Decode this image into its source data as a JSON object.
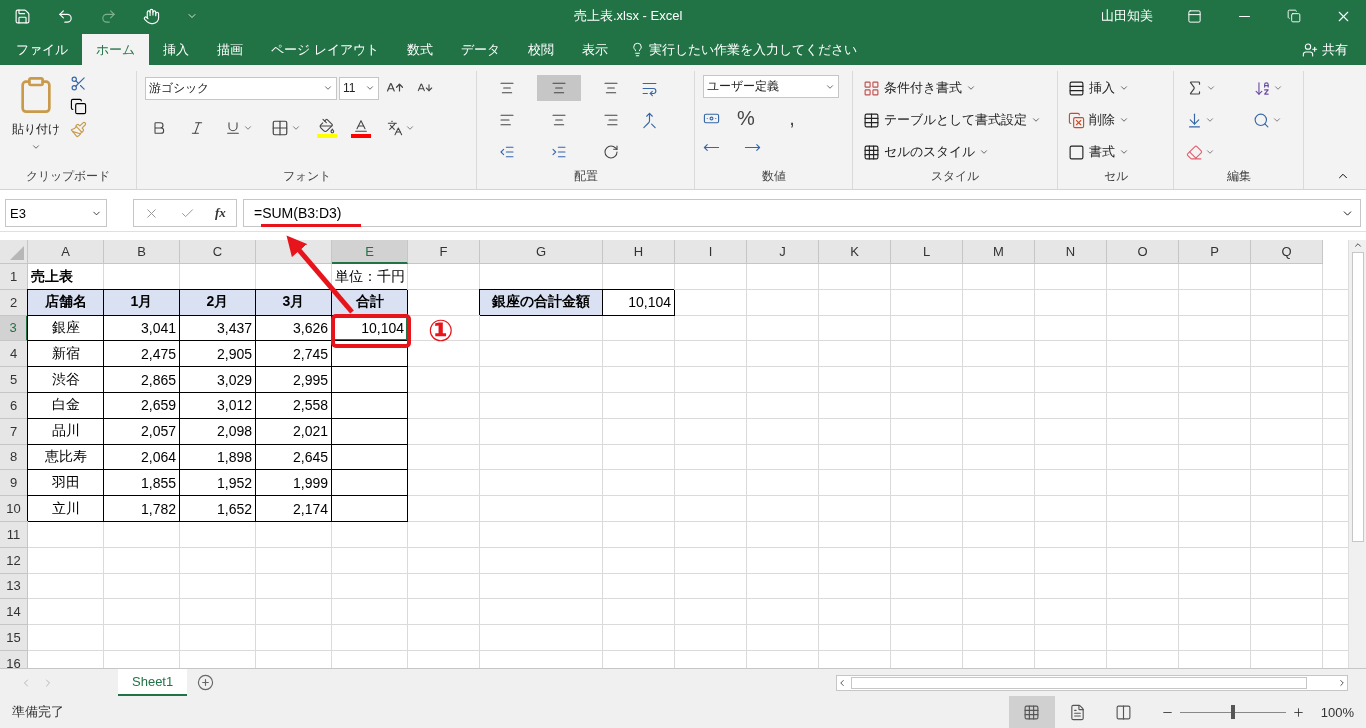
{
  "window": {
    "title": "売上表.xlsx  -  Excel",
    "user": "山田知美"
  },
  "tabs": [
    {
      "label": "ファイル",
      "selected": false
    },
    {
      "label": "ホーム",
      "selected": true
    },
    {
      "label": "挿入",
      "selected": false
    },
    {
      "label": "描画",
      "selected": false
    },
    {
      "label": "ページ レイアウト",
      "selected": false
    },
    {
      "label": "数式",
      "selected": false
    },
    {
      "label": "データ",
      "selected": false
    },
    {
      "label": "校閲",
      "selected": false
    },
    {
      "label": "表示",
      "selected": false
    }
  ],
  "tell_me": {
    "placeholder": "実行したい作業を入力してください"
  },
  "share": "共有",
  "ribbon": {
    "clipboard": {
      "paste": "貼り付け",
      "label": "クリップボード"
    },
    "font": {
      "font_name": "游ゴシック",
      "font_size": "11",
      "label": "フォント"
    },
    "alignment": {
      "vertical": [
        {
          "selected": false
        },
        {
          "selected": true
        },
        {
          "selected": false
        }
      ],
      "label": "配置"
    },
    "number": {
      "format": "ユーザー定義",
      "percent": "%",
      "comma": ",",
      "label": "数値"
    },
    "styles": {
      "buttons": [
        "条件付き書式",
        "テーブルとして書式設定",
        "セルのスタイル"
      ],
      "label": "スタイル"
    },
    "cells": {
      "buttons": [
        "挿入",
        "削除",
        "書式"
      ],
      "label": "セル"
    },
    "editing": {
      "label": "編集"
    }
  },
  "formula_bar": {
    "name_box": "E3",
    "function_label": "fx",
    "formula": "=SUM(B3:D3)"
  },
  "columns": [
    {
      "label": "A",
      "selected": false
    },
    {
      "label": "B",
      "selected": false
    },
    {
      "label": "C",
      "selected": false
    },
    {
      "selected": false
    },
    {
      "label": "E",
      "selected": true
    },
    {
      "label": "F",
      "selected": false
    },
    {
      "label": "G",
      "selected": false
    },
    {
      "label": "H",
      "selected": false
    },
    {
      "label": "I",
      "selected": false
    },
    {
      "label": "J",
      "selected": false
    },
    {
      "label": "K",
      "selected": false
    },
    {
      "label": "L",
      "selected": false
    },
    {
      "label": "M",
      "selected": false
    },
    {
      "label": "N",
      "selected": false
    },
    {
      "label": "O",
      "selected": false
    },
    {
      "label": "P",
      "selected": false
    },
    {
      "label": "Q",
      "selected": false
    }
  ],
  "rows": [
    {
      "number": "1",
      "selected": false,
      "cells": [
        {
          "kind": "title",
          "text": "売上表"
        },
        {
          "kind": "empty"
        },
        {
          "kind": "empty"
        },
        {
          "kind": "empty"
        },
        {
          "kind": "note",
          "text": "単位：千円"
        }
      ]
    },
    {
      "number": "2",
      "selected": false,
      "cells": [
        {
          "kind": "header",
          "text": "店舗名"
        },
        {
          "kind": "header",
          "text": "1月"
        },
        {
          "kind": "header",
          "text": "2月"
        },
        {
          "kind": "header",
          "text": "3月"
        },
        {
          "kind": "header",
          "text": "合計"
        },
        {
          "kind": "empty"
        },
        {
          "kind": "header",
          "text": "銀座の合計金額"
        },
        {
          "kind": "num",
          "text": "10,104"
        }
      ]
    },
    {
      "number": "3",
      "selected": true,
      "cells": [
        {
          "kind": "name",
          "text": "銀座"
        },
        {
          "kind": "num",
          "text": "3,041"
        },
        {
          "kind": "num",
          "text": "3,437"
        },
        {
          "kind": "num",
          "text": "3,626"
        },
        {
          "kind": "num",
          "text": "10,104",
          "selected": true
        }
      ]
    },
    {
      "number": "4",
      "selected": false,
      "cells": [
        {
          "kind": "name",
          "text": "新宿"
        },
        {
          "kind": "num",
          "text": "2,475"
        },
        {
          "kind": "num",
          "text": "2,905"
        },
        {
          "kind": "num",
          "text": "2,745"
        },
        {
          "kind": "blank"
        }
      ]
    },
    {
      "number": "5",
      "selected": false,
      "cells": [
        {
          "kind": "name",
          "text": "渋谷"
        },
        {
          "kind": "num",
          "text": "2,865"
        },
        {
          "kind": "num",
          "text": "3,029"
        },
        {
          "kind": "num",
          "text": "2,995"
        },
        {
          "kind": "blank"
        }
      ]
    },
    {
      "number": "6",
      "selected": false,
      "cells": [
        {
          "kind": "name",
          "text": "白金"
        },
        {
          "kind": "num",
          "text": "2,659"
        },
        {
          "kind": "num",
          "text": "3,012"
        },
        {
          "kind": "num",
          "text": "2,558"
        },
        {
          "kind": "blank"
        }
      ]
    },
    {
      "number": "7",
      "selected": false,
      "cells": [
        {
          "kind": "name",
          "text": "品川"
        },
        {
          "kind": "num",
          "text": "2,057"
        },
        {
          "kind": "num",
          "text": "2,098"
        },
        {
          "kind": "num",
          "text": "2,021"
        },
        {
          "kind": "blank"
        }
      ]
    },
    {
      "number": "8",
      "selected": false,
      "cells": [
        {
          "kind": "name",
          "text": "恵比寿"
        },
        {
          "kind": "num",
          "text": "2,064"
        },
        {
          "kind": "num",
          "text": "1,898"
        },
        {
          "kind": "num",
          "text": "2,645"
        },
        {
          "kind": "blank"
        }
      ]
    },
    {
      "number": "9",
      "selected": false,
      "cells": [
        {
          "kind": "name",
          "text": "羽田"
        },
        {
          "kind": "num",
          "text": "1,855"
        },
        {
          "kind": "num",
          "text": "1,952"
        },
        {
          "kind": "num",
          "text": "1,999"
        },
        {
          "kind": "blank"
        }
      ]
    },
    {
      "number": "10",
      "selected": false,
      "cells": [
        {
          "kind": "name",
          "text": "立川"
        },
        {
          "kind": "num",
          "text": "1,782"
        },
        {
          "kind": "num",
          "text": "1,652"
        },
        {
          "kind": "num",
          "text": "2,174"
        },
        {
          "kind": "blank"
        }
      ]
    },
    {
      "number": "11",
      "selected": false,
      "cells": []
    },
    {
      "number": "12",
      "selected": false,
      "cells": []
    },
    {
      "number": "13",
      "selected": false,
      "cells": []
    },
    {
      "number": "14",
      "selected": false,
      "cells": []
    },
    {
      "number": "15",
      "selected": false,
      "cells": []
    },
    {
      "number": "16",
      "selected": false,
      "cells": []
    }
  ],
  "annotation": {
    "badge": "①"
  },
  "sheets": [
    {
      "label": "Sheet1",
      "selected": true
    }
  ],
  "status_bar": {
    "text": "準備完了",
    "views": [
      {
        "selected": true
      },
      {
        "selected": false
      },
      {
        "selected": false
      }
    ],
    "zoom": {
      "level": 0.5,
      "reading": "100%"
    }
  }
}
